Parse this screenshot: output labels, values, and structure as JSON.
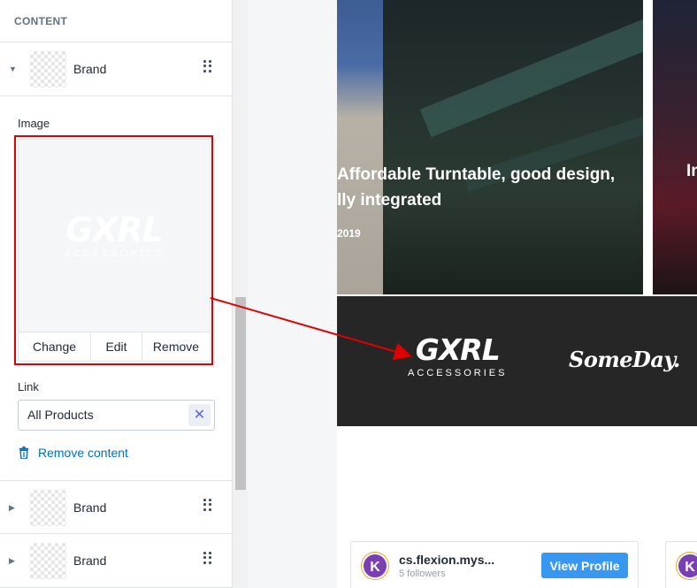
{
  "sidebar": {
    "section_title": "CONTENT",
    "blocks": [
      {
        "label": "Brand",
        "expanded": true
      },
      {
        "label": "Brand",
        "expanded": false
      },
      {
        "label": "Brand",
        "expanded": false
      }
    ],
    "image_field": {
      "label": "Image",
      "logo_text": "GXRL",
      "logo_subtext": "ACCESSORIES",
      "actions": {
        "change": "Change",
        "edit": "Edit",
        "remove": "Remove"
      }
    },
    "link_field": {
      "label": "Link",
      "value": "All Products",
      "clear_icon": "close-icon"
    },
    "remove_content": "Remove content"
  },
  "preview": {
    "blog": {
      "title_line1": "Affordable Turntable, good design,",
      "title_line2": "lly integrated",
      "date": "2019",
      "next_title": "In"
    },
    "brands": {
      "gxrl_main": "GXRL",
      "gxrl_sub": "ACCESSORIES",
      "someday": "SomeDay."
    },
    "instagram": {
      "avatar_letter": "K",
      "name": "cs.flexion.mys...",
      "followers": "5 followers",
      "button": "View Profile",
      "avatar_letter_2": "K"
    }
  },
  "colors": {
    "annotation": "#e00000",
    "link_blue": "#006fbb",
    "instagram_button": "#3897f0",
    "brand_strip": "#262626"
  }
}
